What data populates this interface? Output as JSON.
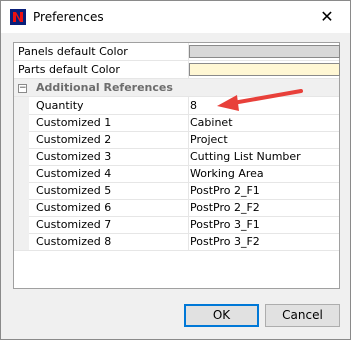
{
  "window": {
    "title": "Preferences",
    "close_glyph": "✕",
    "app_icon": "app-logo-icon"
  },
  "properties": {
    "panels_default_color": {
      "label": "Panels default Color",
      "value_color": "#d8d8d8"
    },
    "parts_default_color": {
      "label": "Parts default Color",
      "value_color": "#fff7d4"
    },
    "category": {
      "label": "Additional References",
      "expander": "−"
    },
    "rows": [
      {
        "label": "Quantity",
        "value": "8"
      },
      {
        "label": "Customized 1",
        "value": "Cabinet"
      },
      {
        "label": "Customized 2",
        "value": "Project"
      },
      {
        "label": "Customized 3",
        "value": "Cutting List Number"
      },
      {
        "label": "Customized 4",
        "value": "Working Area"
      },
      {
        "label": "Customized 5",
        "value": "PostPro 2_F1"
      },
      {
        "label": "Customized 6",
        "value": "PostPro 2_F2"
      },
      {
        "label": "Customized 7",
        "value": "PostPro 3_F1"
      },
      {
        "label": "Customized 8",
        "value": "PostPro 3_F2"
      }
    ]
  },
  "annotation": {
    "arrow_color": "#e8403a"
  },
  "buttons": {
    "ok": "OK",
    "cancel": "Cancel"
  }
}
